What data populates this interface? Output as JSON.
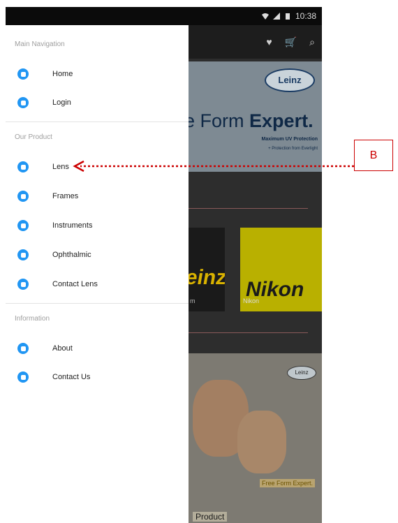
{
  "status_bar": {
    "time": "10:38"
  },
  "drawer": {
    "sections": [
      {
        "title": "Main Navigation",
        "items": [
          {
            "label": "Home",
            "icon": "home-icon"
          },
          {
            "label": "Login",
            "icon": "lock-icon"
          }
        ]
      },
      {
        "title": "Our Product",
        "items": [
          {
            "label": "Lens",
            "icon": "lens-icon"
          },
          {
            "label": "Frames",
            "icon": "frames-icon"
          },
          {
            "label": "Instruments",
            "icon": "instruments-icon"
          },
          {
            "label": "Ophthalmic",
            "icon": "ophthalmic-icon"
          },
          {
            "label": "Contact Lens",
            "icon": "contact-lens-icon"
          }
        ]
      },
      {
        "title": "Information",
        "items": [
          {
            "label": "About",
            "icon": "info-icon"
          },
          {
            "label": "Contact Us",
            "icon": "phone-icon"
          }
        ]
      }
    ]
  },
  "background_app": {
    "banner_tagline_part1": "e Form",
    "banner_tagline_part2": "Expert.",
    "banner_logo": "Leinz",
    "banner_sub1": "Maximum UV Protection",
    "banner_sub2": "+ Protection from Everlight",
    "brand1_text": "einz",
    "brand1_label": "m",
    "brand2_text": "Nikon",
    "brand2_label": "Nikon",
    "poster_logo": "Leinz",
    "poster_expert": "Free Form Expert.",
    "poster_footer": "Product"
  },
  "annotation": {
    "label": "B"
  },
  "colors": {
    "accent": "#2196f3",
    "annotation": "#cc0000"
  }
}
